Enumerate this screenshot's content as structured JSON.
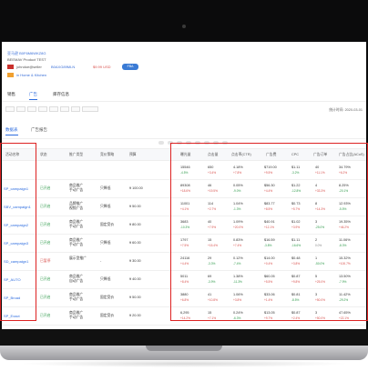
{
  "product": {
    "link": "亚马逊 B0F6M6WKZ8G",
    "title": "BEEMAV Product TEST",
    "seller": "johndoe@seller",
    "asin": "B0AXG89MLN",
    "price": "$9.99 USD",
    "badge": "FBA",
    "category": "in Home & Kitchen"
  },
  "main_tabs": [
    "销售",
    "广告",
    "库存信息"
  ],
  "stat_time": "统计时间: 2020-03-01",
  "sub_tabs": [
    "数据表",
    "广告报告"
  ],
  "columns": [
    "活动名称",
    "状态",
    "推广类型",
    "竞价策略",
    "预算",
    "曝光量",
    "点击量",
    "点击率(CTR)",
    "广告费",
    "CPC",
    "广告订单",
    "广告占比(ACoS)"
  ],
  "rows": [
    {
      "campaign": "",
      "status": "",
      "type": "",
      "bid": "",
      "budget": "",
      "imp": "15546",
      "imp_d": "-4.5%",
      "clk": "650",
      "clk_d": "+3.4%",
      "ctr": "4.18%",
      "ctr_d": "+7.8%",
      "spend": "$719.00",
      "spend_d": "+9.5%",
      "cpc": "$1.11",
      "cpc_d": "-3.2%",
      "orders": "40",
      "orders_d": "+11.1%",
      "acos": "34.79%",
      "acos_d": "+6.2%"
    },
    {
      "campaign": "SP_campaign1",
      "status": "已开启",
      "type": "商品推广\n手动广告",
      "bid": "只降低",
      "budget": "¥ 100.00",
      "imp": "89308",
      "imp_d": "+18.6%",
      "clk": "46",
      "clk_d": "+19.5%",
      "ctr": "0.05%",
      "ctr_d": "-9.0%",
      "spend": "$56.30",
      "spend_d": "+4.4%",
      "cpc": "$1.22",
      "cpc_d": "-12.8%",
      "orders": "4",
      "orders_d": "+33.3%",
      "acos": "8.25%",
      "acos_d": "-20.1%"
    },
    {
      "campaign": "SBV_campaign1",
      "status": "已开启",
      "type": "品牌推广\n视频广告",
      "bid": "只降低",
      "budget": "¥ 50.00",
      "imp": "11001",
      "imp_d": "+4.1%",
      "clk": "114",
      "clk_d": "+2.7%",
      "ctr": "1.04%",
      "ctr_d": "-1.3%",
      "spend": "$83.77",
      "spend_d": "+8.5%",
      "cpc": "$0.73",
      "cpc_d": "+5.7%",
      "orders": "8",
      "orders_d": "+14.3%",
      "acos": "12.93%",
      "acos_d": "-5.5%"
    },
    {
      "campaign": "SP_campaign2",
      "status": "已开启",
      "type": "商品推广\n手动广告",
      "bid": "固定竞价",
      "budget": "¥ 80.00",
      "imp": "3683",
      "imp_d": "-10.3%",
      "clk": "40",
      "clk_d": "+7.9%",
      "ctr": "1.09%",
      "ctr_d": "+20.0%",
      "spend": "$40.91",
      "spend_d": "+12.1%",
      "cpc": "$1.02",
      "cpc_d": "+3.9%",
      "orders": "3",
      "orders_d": "-25.0%",
      "acos": "19.35%",
      "acos_d": "+46.2%"
    },
    {
      "campaign": "SP_campaign3",
      "status": "已开启",
      "type": "商品推广\n手动广告",
      "bid": "只降低",
      "budget": "¥ 60.00",
      "imp": "1797",
      "imp_d": "+7.5%",
      "clk": "15",
      "clk_d": "+15.4%",
      "ctr": "0.83%",
      "ctr_d": "+7.4%",
      "spend": "$16.59",
      "spend_d": "-3.8%",
      "cpc": "$1.11",
      "cpc_d": "-16.6%",
      "orders": "2",
      "orders_d": "0.0%",
      "acos": "11.06%",
      "acos_d": "-8.3%"
    },
    {
      "campaign": "SD_campaign1",
      "status": "已暂停",
      "type": "展示型推广",
      "bid": "-",
      "budget": "¥ 30.00",
      "imp": "24116",
      "imp_d": "+4.4%",
      "clk": "29",
      "clk_d": "-3.3%",
      "ctr": "0.12%",
      "ctr_d": "-7.4%",
      "spend": "$14.00",
      "spend_d": "+0.4%",
      "cpc": "$0.48",
      "cpc_d": "+3.8%",
      "orders": "1",
      "orders_d": "-50.0%",
      "acos": "15.32%",
      "acos_d": "+100.7%"
    },
    {
      "campaign": "SP_AUTO",
      "status": "已开启",
      "type": "商品推广\n自动广告",
      "bid": "只降低",
      "budget": "¥ 40.00",
      "imp": "5011",
      "imp_d": "+8.4%",
      "clk": "69",
      "clk_d": "-3.9%",
      "ctr": "1.38%",
      "ctr_d": "-11.3%",
      "spend": "$60.05",
      "spend_d": "+5.5%",
      "cpc": "$0.87",
      "cpc_d": "+9.8%",
      "orders": "5",
      "orders_d": "+25.0%",
      "acos": "13.50%",
      "acos_d": "-7.9%"
    },
    {
      "campaign": "SP_Broad",
      "status": "已开启",
      "type": "商品推广\n手动广告",
      "bid": "固定竞价",
      "budget": "¥ 50.00",
      "imp": "3880",
      "imp_d": "+6.8%",
      "clk": "41",
      "clk_d": "+10.8%",
      "ctr": "1.06%",
      "ctr_d": "+3.8%",
      "spend": "$33.06",
      "spend_d": "+1.4%",
      "cpc": "$0.81",
      "cpc_d": "-8.5%",
      "orders": "3",
      "orders_d": "+50.0%",
      "acos": "11.42%",
      "acos_d": "-29.2%"
    },
    {
      "campaign": "SP_Exact",
      "status": "已开启",
      "type": "商品推广\n手动广告",
      "bid": "固定竞价",
      "budget": "¥ 20.00",
      "imp": "6,295",
      "imp_d": "+14.2%",
      "clk": "15",
      "clk_d": "+7.1%",
      "ctr": "0.24%",
      "ctr_d": "-6.3%",
      "spend": "$13.05",
      "spend_d": "+9.7%",
      "cpc": "$0.87",
      "cpc_d": "+2.4%",
      "orders": "3",
      "orders_d": "+50.0%",
      "acos": "47.65%",
      "acos_d": "+22.1%"
    }
  ],
  "colors": {
    "accent": "#2d6cdf",
    "highlight_box": "#d22222",
    "positive": "#d9534f",
    "negative": "#2e9a4a"
  }
}
